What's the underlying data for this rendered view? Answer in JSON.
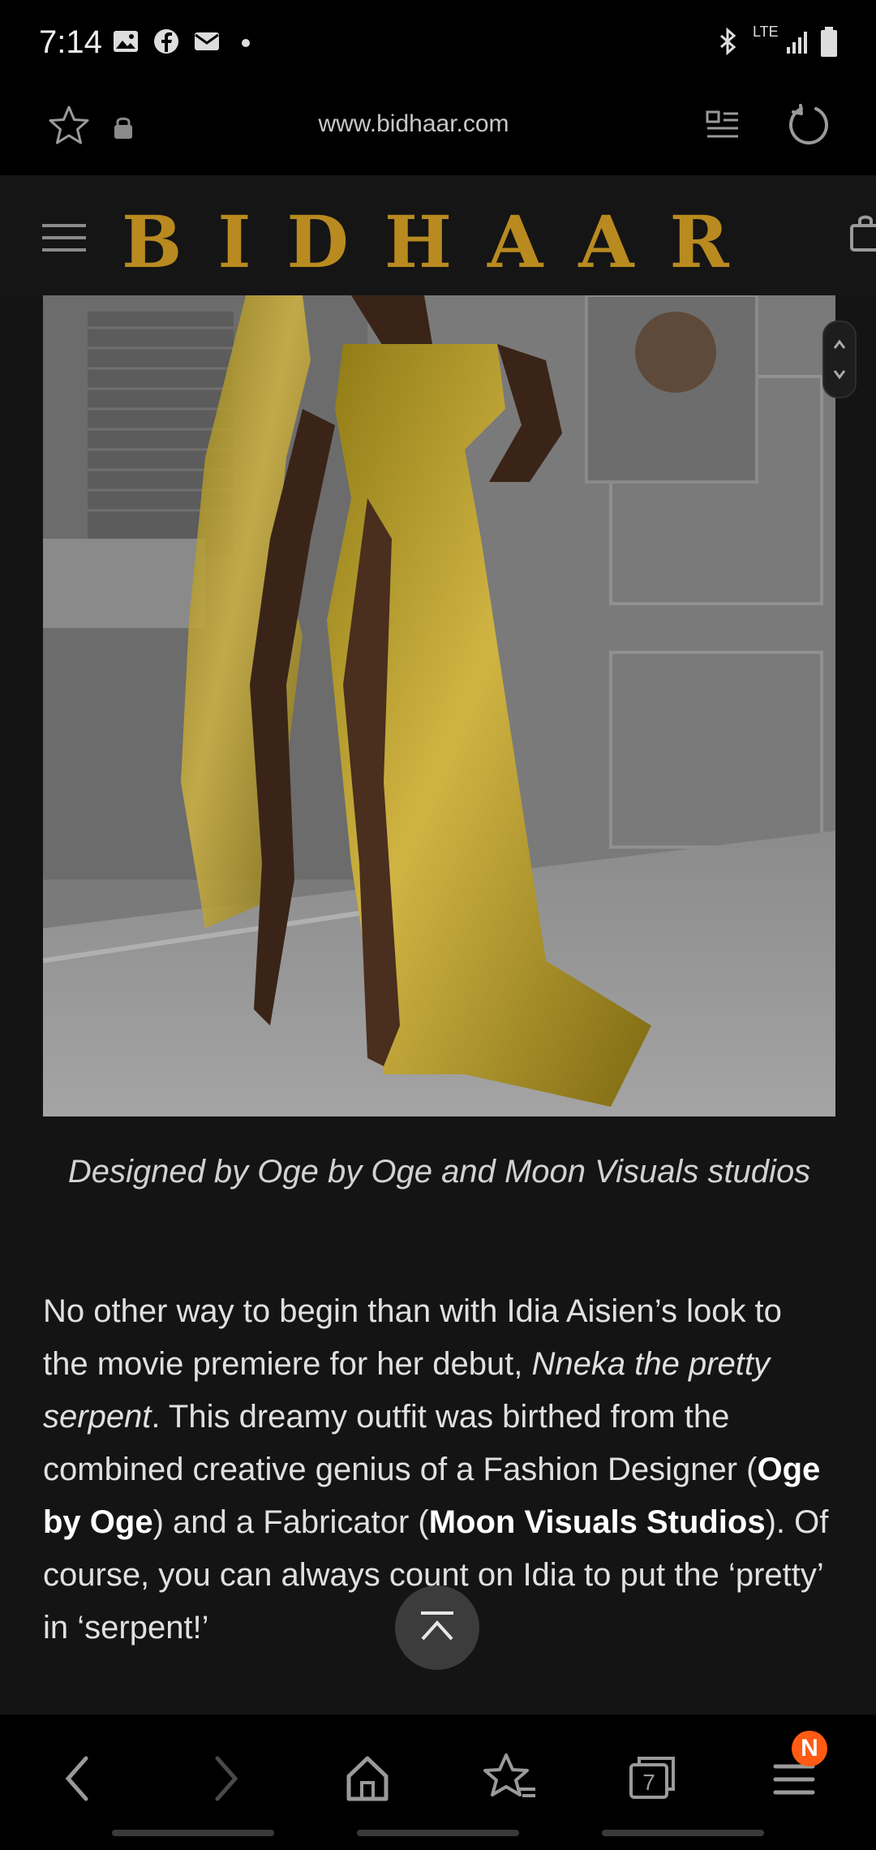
{
  "status_bar": {
    "time": "7:14",
    "left_icons": [
      "gallery-icon",
      "facebook-icon",
      "mail-icon",
      "notification-dot"
    ],
    "right_icons": [
      "bluetooth-icon",
      "lte-icon",
      "signal-icon",
      "battery-icon"
    ],
    "network": "LTE"
  },
  "browser": {
    "url": "www.bidhaar.com",
    "left_icons": [
      "star-icon",
      "lock-icon"
    ],
    "right_icons": [
      "reader-mode-icon",
      "reload-icon"
    ]
  },
  "site": {
    "logo": "BIDHAAR",
    "menu_icon": "hamburger-icon",
    "cart_icon": "cart-icon",
    "brand_color": "#b88a1f"
  },
  "article": {
    "caption": "Designed by Oge by Oge and Moon Visuals studios",
    "paragraph": {
      "part1": "No other way to begin than with Idia Aisien’s look to the movie premiere for her debut, ",
      "movie": "Nneka the pretty serpent",
      "part2": ". This dreamy outfit was birthed from the combined creative genius of a Fashion Designer (",
      "designer": "Oge by Oge",
      "part3": ") and a Fabricator (",
      "fabricator": "Moon Visuals Studios",
      "part4": "). Of course, you can always count on Idia to put the ‘pretty’ in ‘serpent!’"
    }
  },
  "bottom_nav": {
    "tabs_count": "7",
    "badge": "N",
    "icons": [
      "back-icon",
      "forward-icon",
      "home-icon",
      "bookmarks-icon",
      "tabs-icon",
      "menu-icon"
    ]
  },
  "colors": {
    "background": "#141414",
    "badge": "#ff5b14",
    "gold_dress": "#b89a2a"
  }
}
